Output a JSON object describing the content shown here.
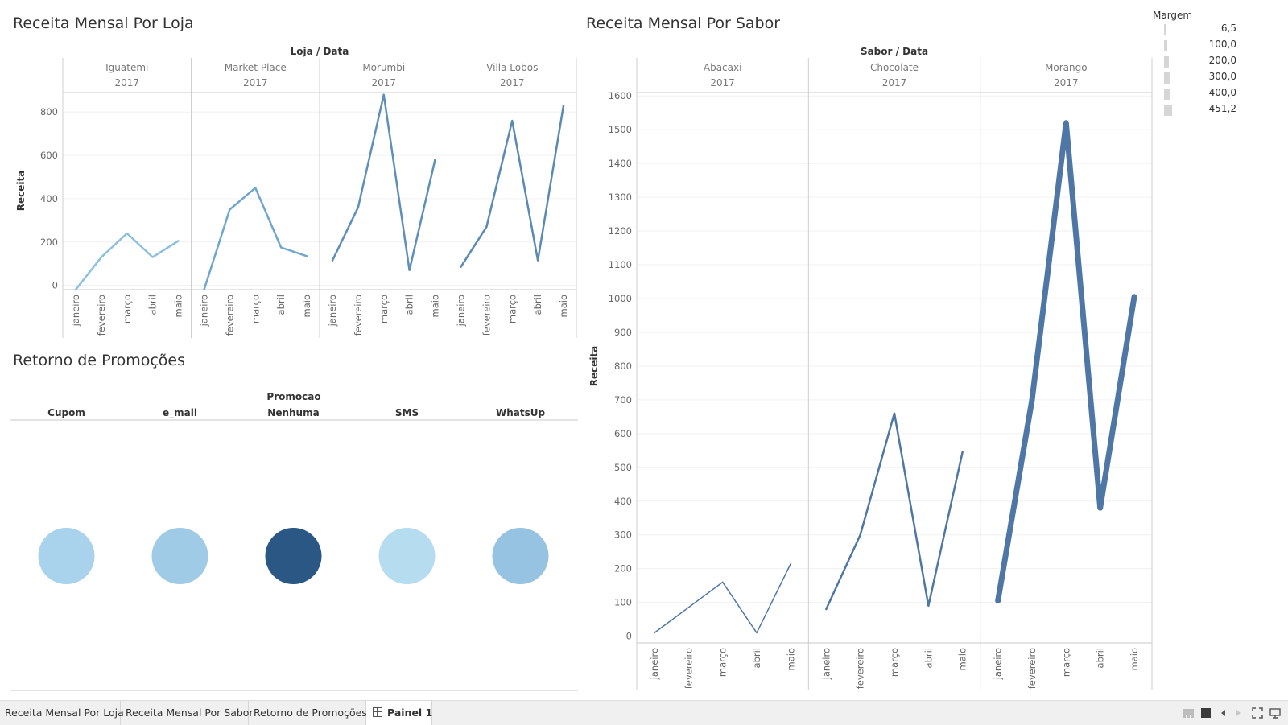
{
  "dashboard": {
    "titles": {
      "loja": "Receita Mensal Por Loja",
      "sabor": "Receita Mensal Por Sabor",
      "promo": "Retorno de Promoções"
    }
  },
  "legend": {
    "title": "Margem",
    "items": [
      "6,5",
      "100,0",
      "200,0",
      "300,0",
      "400,0",
      "451,2"
    ]
  },
  "tabs": [
    {
      "label": "Receita Mensal Por Loja"
    },
    {
      "label": "Receita Mensal Por Sabor"
    },
    {
      "label": "Retorno de Promoções"
    },
    {
      "label": "Painel 1",
      "active": true
    }
  ],
  "chart_data": [
    {
      "type": "line",
      "title": "Receita Mensal Por Loja",
      "header": "Loja / Data",
      "ylabel": "Receita",
      "yticks": [
        0,
        200,
        400,
        600,
        800
      ],
      "ylim": [
        -20,
        890
      ],
      "year": "2017",
      "categories": [
        "janeiro",
        "fevereiro",
        "março",
        "abril",
        "maio"
      ],
      "series": [
        {
          "name": "Iguatemi",
          "values": [
            -20,
            130,
            240,
            130,
            205
          ],
          "color": "#8cbfe0"
        },
        {
          "name": "Market Place",
          "values": [
            -20,
            350,
            450,
            175,
            135
          ],
          "color": "#6fa6cf"
        },
        {
          "name": "Morumbi",
          "values": [
            115,
            360,
            880,
            70,
            580
          ],
          "color": "#5e8fba"
        },
        {
          "name": "Villa Lobos",
          "values": [
            85,
            270,
            760,
            115,
            830
          ],
          "color": "#5a89b6"
        }
      ]
    },
    {
      "type": "line",
      "title": "Receita Mensal Por Sabor",
      "header": "Sabor / Data",
      "ylabel": "Receita",
      "yticks": [
        0,
        100,
        200,
        300,
        400,
        500,
        600,
        700,
        800,
        900,
        1000,
        1100,
        1200,
        1300,
        1400,
        1500,
        1600
      ],
      "ylim": [
        -20,
        1610
      ],
      "year": "2017",
      "categories": [
        "janeiro",
        "fevereiro",
        "março",
        "abril",
        "maio"
      ],
      "series": [
        {
          "name": "Abacaxi",
          "values": [
            10,
            85,
            160,
            10,
            215
          ],
          "width": 1.5
        },
        {
          "name": "Chocolate",
          "values": [
            80,
            300,
            660,
            90,
            545
          ],
          "width": 2.5
        },
        {
          "name": "Morango",
          "values": [
            105,
            700,
            1520,
            380,
            1005
          ],
          "width": 7
        }
      ]
    },
    {
      "type": "scatter",
      "title": "Retorno de Promoções",
      "header": "Promocao",
      "categories": [
        "Cupom",
        "e_mail",
        "Nenhuma",
        "SMS",
        "WhatsUp"
      ],
      "colors": [
        "#a9d2ec",
        "#a0cbe6",
        "#2a5784",
        "#b6dcf0",
        "#97c3e2"
      ]
    }
  ]
}
